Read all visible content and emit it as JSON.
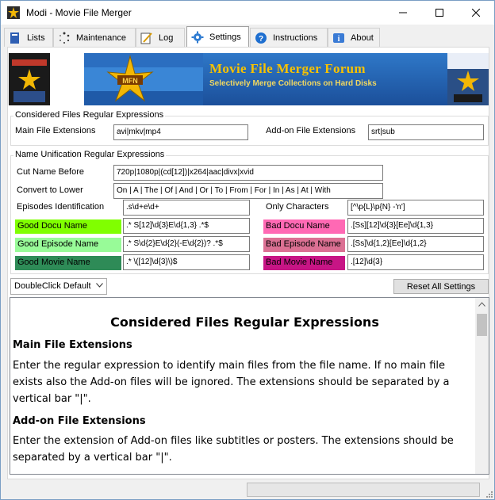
{
  "window": {
    "title": "Modi - Movie File Merger"
  },
  "tabs": [
    {
      "label": "Lists",
      "icon": "book-icon"
    },
    {
      "label": "Maintenance",
      "icon": "spinner-icon"
    },
    {
      "label": "Log",
      "icon": "pencil-note-icon"
    },
    {
      "label": "Settings",
      "icon": "gear-icon",
      "active": true
    },
    {
      "label": "Instructions",
      "icon": "help-icon"
    },
    {
      "label": "About",
      "icon": "info-icon"
    }
  ],
  "banner": {
    "logo_text": "MFN",
    "title": "Movie File Merger Forum",
    "subtitle": "Selectively Merge Collections on Hard Disks"
  },
  "considered": {
    "legend": "Considered Files Regular Expressions",
    "main_label": "Main File Extensions",
    "main_value": "avi|mkv|mp4",
    "addon_label": "Add-on File Extensions",
    "addon_value": "srt|sub"
  },
  "unification": {
    "legend": "Name Unification Regular Expressions",
    "cut_label": "Cut Name Before",
    "cut_value": "720p|1080p|(cd[12])|x264|aac|divx|xvid",
    "lower_label": "Convert to Lower",
    "lower_value": "On | A | The | Of | And | Or | To | From | For | In | As | At | With",
    "episodes_label": "Episodes Identification",
    "episodes_value": ".s\\d+e\\d+",
    "only_label": "Only Characters",
    "only_value": "[^\\p{L}\\p{N} -'n']",
    "good_docu_label": "Good Docu Name",
    "good_docu_value": ".* S[12]\\d{3}E\\d{1,3} .*$",
    "bad_docu_label": "Bad Docu Name",
    "bad_docu_value": ".[Ss][12]\\d{3}[Ee]\\d{1,3}",
    "good_episode_label": "Good Episode Name",
    "good_episode_value": ".* S\\d{2}E\\d{2}(-E\\d{2})? .*$",
    "bad_episode_label": "Bad Episode Name",
    "bad_episode_value": ".[Ss]\\d{1,2}[Ee]\\d{1,2}",
    "good_movie_label": "Good Movie Name",
    "good_movie_value": ".* \\([12]\\d{3}\\)$",
    "bad_movie_label": "Bad Movie Name",
    "bad_movie_value": ".[12]\\d{3}"
  },
  "colors": {
    "good_docu": "#80ff00",
    "good_episode": "#98fb98",
    "good_movie": "#2e8b57",
    "bad_docu": "#ff69b4",
    "bad_episode": "#db7093",
    "bad_movie": "#c71585"
  },
  "controls": {
    "dropdown_value": "DoubleClick Default",
    "reset_label": "Reset All Settings"
  },
  "help": {
    "title": "Considered Files Regular Expressions",
    "main_heading": "Main File Extensions",
    "main_text": "Enter the regular expression to identify main files from the file name.  If no main file exists also the Add-on files will be ignored.  The extensions should be separated by a vertical bar \"|\".",
    "addon_heading": "Add-on File Extensions",
    "addon_text": "Enter the extension of Add-on files like subtitles or posters.  The extensions should be separated by a vertical bar \"|\"."
  }
}
